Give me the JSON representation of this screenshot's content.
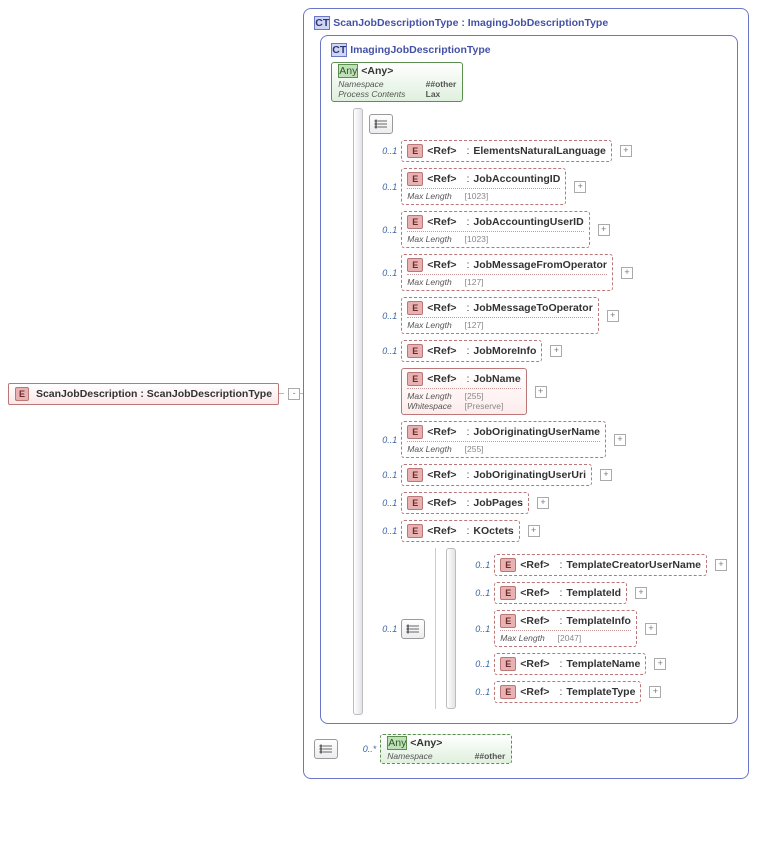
{
  "root_element": {
    "badge": "E",
    "label": "ScanJobDescription : ScanJobDescriptionType"
  },
  "ct_outer": {
    "badge": "CT",
    "label": "ScanJobDescriptionType : ImagingJobDescriptionType"
  },
  "ct_inner": {
    "badge": "CT",
    "label": "ImagingJobDescriptionType"
  },
  "any_top": {
    "badge": "Any",
    "label": "<Any>",
    "namespace_k": "Namespace",
    "namespace_v": "##other",
    "pc_k": "Process Contents",
    "pc_v": "Lax"
  },
  "refs": [
    {
      "card": "0..1",
      "name": "ElementsNaturalLanguage",
      "solid": false
    },
    {
      "card": "0..1",
      "name": "JobAccountingID",
      "solid": false,
      "constraints": [
        {
          "k": "Max Length",
          "v": "[1023]"
        }
      ]
    },
    {
      "card": "0..1",
      "name": "JobAccountingUserID",
      "solid": false,
      "constraints": [
        {
          "k": "Max Length",
          "v": "[1023]"
        }
      ]
    },
    {
      "card": "0..1",
      "name": "JobMessageFromOperator",
      "solid": false,
      "constraints": [
        {
          "k": "Max Length",
          "v": "[127]"
        }
      ]
    },
    {
      "card": "0..1",
      "name": "JobMessageToOperator",
      "solid": false,
      "constraints": [
        {
          "k": "Max Length",
          "v": "[127]"
        }
      ]
    },
    {
      "card": "0..1",
      "name": "JobMoreInfo",
      "solid": false
    },
    {
      "card": "",
      "name": "JobName",
      "solid": true,
      "constraints": [
        {
          "k": "Max Length",
          "v": "[255]"
        },
        {
          "k": "Whitespace",
          "v": "[Preserve]"
        }
      ]
    },
    {
      "card": "0..1",
      "name": "JobOriginatingUserName",
      "solid": false,
      "constraints": [
        {
          "k": "Max Length",
          "v": "[255]"
        }
      ]
    },
    {
      "card": "0..1",
      "name": "JobOriginatingUserUri",
      "solid": false
    },
    {
      "card": "0..1",
      "name": "JobPages",
      "solid": false
    },
    {
      "card": "0..1",
      "name": "KOctets",
      "solid": false
    }
  ],
  "template_seq_card": "0..1",
  "refs_template": [
    {
      "card": "0..1",
      "name": "TemplateCreatorUserName"
    },
    {
      "card": "0..1",
      "name": "TemplateId"
    },
    {
      "card": "0..1",
      "name": "TemplateInfo",
      "constraints": [
        {
          "k": "Max Length",
          "v": "[2047]"
        }
      ]
    },
    {
      "card": "0..1",
      "name": "TemplateName"
    },
    {
      "card": "0..1",
      "name": "TemplateType"
    }
  ],
  "any_bottom": {
    "card": "0..*",
    "badge": "Any",
    "label": "<Any>",
    "namespace_k": "Namespace",
    "namespace_v": "##other"
  },
  "labels": {
    "ref": "<Ref>",
    "colon": ":",
    "E": "E"
  }
}
